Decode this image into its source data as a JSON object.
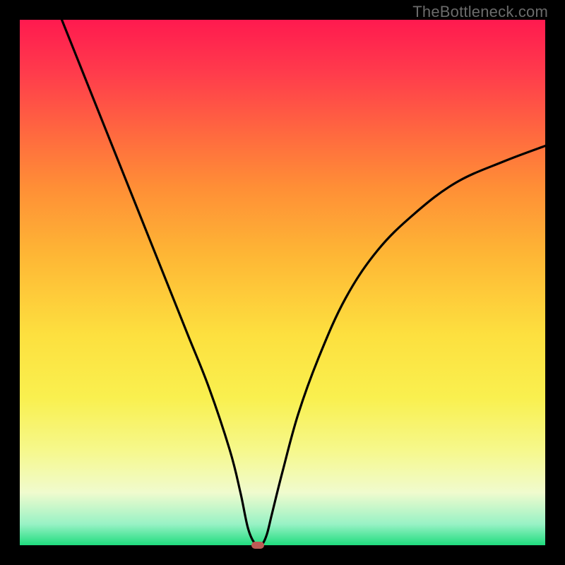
{
  "watermark": "TheBottleneck.com",
  "chart_data": {
    "type": "line",
    "title": "",
    "xlabel": "",
    "ylabel": "",
    "xlim": [
      0,
      100
    ],
    "ylim": [
      0,
      100
    ],
    "grid": false,
    "series": [
      {
        "name": "bottleneck-curve",
        "x": [
          8,
          12,
          16,
          20,
          24,
          28,
          32,
          36,
          40,
          42,
          43.5,
          45,
          46,
          47,
          48,
          50,
          53,
          57,
          62,
          68,
          75,
          83,
          92,
          100
        ],
        "y": [
          100,
          90,
          80,
          70,
          60,
          50,
          40,
          30,
          18,
          10,
          3,
          0,
          0,
          2,
          6,
          14,
          25,
          36,
          47,
          56,
          63,
          69,
          73,
          76
        ]
      }
    ],
    "marker": {
      "x": 45.3,
      "y": 0,
      "color": "#bd5a55"
    },
    "gradient_stops": [
      {
        "pos": 0.0,
        "color": "#ff1a4f"
      },
      {
        "pos": 0.45,
        "color": "#feb735"
      },
      {
        "pos": 0.72,
        "color": "#f9f04f"
      },
      {
        "pos": 0.96,
        "color": "#98f2c5"
      },
      {
        "pos": 1.0,
        "color": "#1fdc7e"
      }
    ]
  }
}
